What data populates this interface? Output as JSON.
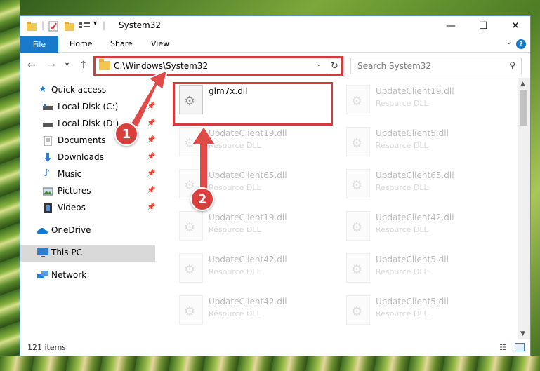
{
  "window": {
    "title": "System32"
  },
  "titlebar_controls": {
    "minimize": "—",
    "maximize": "☐",
    "close": "✕"
  },
  "ribbon": {
    "tabs": [
      "File",
      "Home",
      "Share",
      "View"
    ],
    "help": "?"
  },
  "nav": {
    "back": "←",
    "forward": "→",
    "recent": "▾",
    "up": "↑",
    "address_path": "C:\\Windows\\System32",
    "refresh": "↻",
    "search_placeholder": "Search System32"
  },
  "sidebar": {
    "items": [
      {
        "label": "Quick access",
        "icon": "star-icon",
        "pinned": false
      },
      {
        "label": "Local Disk (C:)",
        "icon": "drive-icon",
        "pinned": true
      },
      {
        "label": "Local Disk (D:)",
        "icon": "drive-icon",
        "pinned": true
      },
      {
        "label": "Documents",
        "icon": "documents-icon",
        "pinned": true
      },
      {
        "label": "Downloads",
        "icon": "downloads-icon",
        "pinned": true
      },
      {
        "label": "Music",
        "icon": "music-icon",
        "pinned": true
      },
      {
        "label": "Pictures",
        "icon": "pictures-icon",
        "pinned": true
      },
      {
        "label": "Videos",
        "icon": "videos-icon",
        "pinned": true
      },
      {
        "label": "OneDrive",
        "icon": "cloud-icon",
        "pinned": false
      },
      {
        "label": "This PC",
        "icon": "computer-icon",
        "pinned": false,
        "selected": true
      },
      {
        "label": "Network",
        "icon": "network-icon",
        "pinned": false
      }
    ]
  },
  "files": [
    {
      "name": "glm7x.dll",
      "type": "",
      "highlighted": true
    },
    {
      "name": "UpdateClient19.dll",
      "type": "Resource DLL"
    },
    {
      "name": "UpdateClient19.dll",
      "type": "Resource DLL"
    },
    {
      "name": "UpdateClient5.dll",
      "type": "Resource DLL"
    },
    {
      "name": "UpdateClient65.dll",
      "type": "Resource DLL"
    },
    {
      "name": "UpdateClient65.dll",
      "type": "Resource DLL"
    },
    {
      "name": "UpdateClient19.dll",
      "type": "Resource DLL"
    },
    {
      "name": "UpdateClient42.dll",
      "type": "Resource DLL"
    },
    {
      "name": "UpdateClient42.dll",
      "type": "Resource DLL"
    },
    {
      "name": "UpdateClient5.dll",
      "type": "Resource DLL"
    },
    {
      "name": "UpdateClient42.dll",
      "type": "Resource DLL"
    },
    {
      "name": "UpdateClient5.dll",
      "type": "Resource DLL"
    }
  ],
  "status": {
    "item_count": "121 items"
  },
  "annotations": {
    "step1": "1",
    "step2": "2",
    "highlight_color": "#d73a3a"
  }
}
